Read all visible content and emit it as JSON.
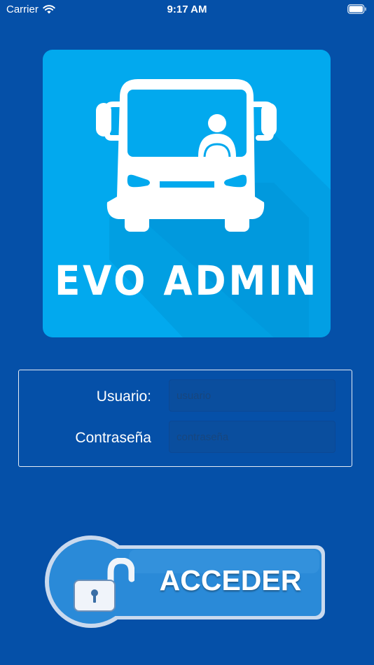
{
  "status_bar": {
    "carrier": "Carrier",
    "time": "9:17 AM",
    "wifi_icon": "wifi-icon",
    "battery_icon": "battery-icon"
  },
  "logo": {
    "title": "EVO ADMIN",
    "icon": "bus-icon",
    "background_color": "#02a9ee"
  },
  "login_form": {
    "username_label": "Usuario:",
    "username_placeholder": "usuario",
    "username_value": "",
    "password_label": "Contraseña",
    "password_placeholder": "contraseña",
    "password_value": ""
  },
  "access_button": {
    "label": "ACCEDER",
    "icon": "unlocked-padlock-icon"
  },
  "colors": {
    "background": "#0550a8",
    "accent": "#02a9ee",
    "button": "#2a8ad8"
  }
}
